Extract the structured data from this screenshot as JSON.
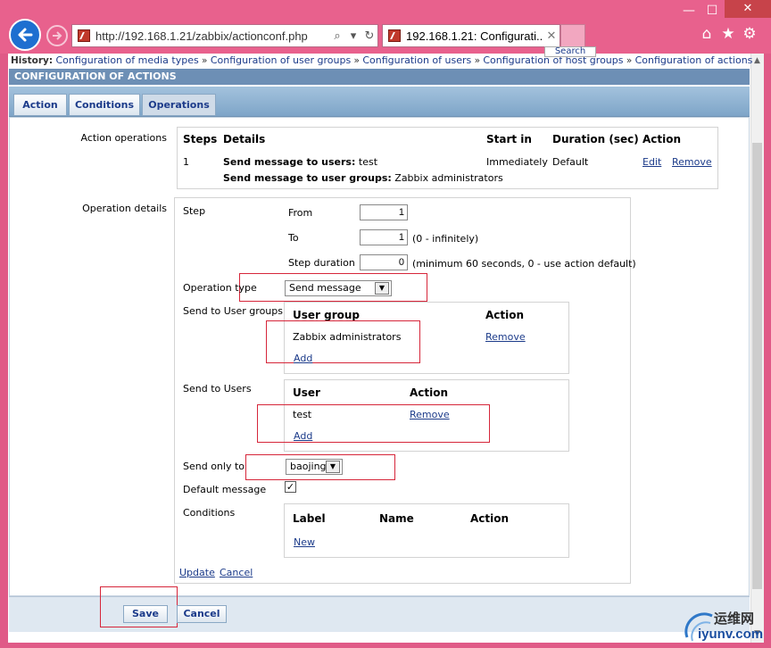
{
  "browser": {
    "address": "http://192.168.1.21/zabbix/actionconf.php",
    "tab_title": "192.168.1.21: Configurati...",
    "search_button": "Search"
  },
  "history": {
    "label": "History:",
    "items": [
      "Configuration of media types",
      "Configuration of user groups",
      "Configuration of users",
      "Configuration of host groups",
      "Configuration of actions"
    ],
    "separator": "»"
  },
  "section_title": "CONFIGURATION OF ACTIONS",
  "tabs": [
    "Action",
    "Conditions",
    "Operations"
  ],
  "action_operations": {
    "label": "Action operations",
    "headers": {
      "steps": "Steps",
      "details": "Details",
      "start_in": "Start in",
      "duration": "Duration (sec)",
      "action": "Action"
    },
    "row": {
      "step": "1",
      "detail_1_bold": "Send message to users:",
      "detail_1_value": "test",
      "detail_2_bold": "Send message to user groups:",
      "detail_2_value": "Zabbix administrators",
      "start_in": "Immediately",
      "duration": "Default",
      "edit": "Edit",
      "remove": "Remove"
    }
  },
  "operation_details": {
    "label": "Operation details",
    "step_label": "Step",
    "from_label": "From",
    "from_value": "1",
    "to_label": "To",
    "to_value": "1",
    "to_hint": "(0 - infinitely)",
    "step_duration_label": "Step duration",
    "step_duration_value": "0",
    "step_duration_hint": "(minimum 60 seconds, 0 - use action default)",
    "operation_type_label": "Operation type",
    "operation_type_value": "Send message",
    "user_groups_label": "Send to User groups",
    "user_groups_headers": {
      "group": "User group",
      "action": "Action"
    },
    "user_group_name": "Zabbix administrators",
    "user_group_remove": "Remove",
    "user_group_add": "Add",
    "users_label": "Send to Users",
    "users_headers": {
      "user": "User",
      "action": "Action"
    },
    "user_name": "test",
    "user_remove": "Remove",
    "user_add": "Add",
    "send_only_to_label": "Send only to",
    "send_only_to_value": "baojing",
    "default_message_label": "Default message",
    "default_message_checked": "✓",
    "conditions_label": "Conditions",
    "conditions_headers": {
      "label": "Label",
      "name": "Name",
      "action": "Action"
    },
    "conditions_new": "New",
    "update": "Update",
    "cancel": "Cancel"
  },
  "footer": {
    "save": "Save",
    "cancel": "Cancel"
  },
  "watermark": {
    "cn": "运维网",
    "en": "iyunv.com"
  }
}
